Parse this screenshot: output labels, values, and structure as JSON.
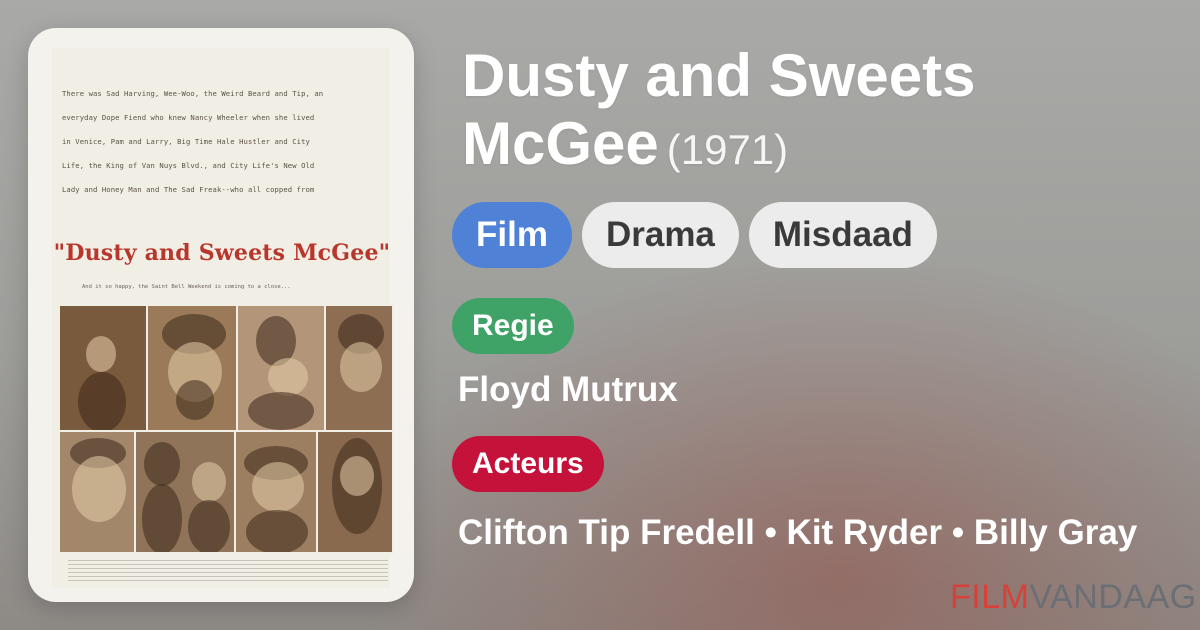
{
  "poster": {
    "blurb": "There was Sad Harving, Wee-Woo, the Weird Beard and Tip, an\neveryday Dope Fiend who knew Nancy Wheeler when she lived\nin Venice, Pam and Larry, Big Time Hale Hustler and City\nLife, the King of Van Nuys Blvd., and City Life's New Old\nLady and Honey Man and The Sad Freak--who all copped from",
    "title": "\"Dusty and Sweets McGee\"",
    "tagline": "And it so happy, the Saint Bell Weekend is coming to a close..."
  },
  "movie": {
    "title": "Dusty and Sweets McGee",
    "year": "(1971)"
  },
  "genres": [
    "Film",
    "Drama",
    "Misdaad"
  ],
  "director": {
    "label": "Regie",
    "name": "Floyd Mutrux"
  },
  "cast": {
    "label": "Acteurs",
    "names": "Clifton Tip Fredell • Kit Ryder • Billy Gray"
  },
  "brand": {
    "part1": "FILM",
    "part2": "VANDAAG"
  },
  "colors": {
    "film_chip": "#4f82d6",
    "regie_badge": "#3fa367",
    "acteurs_badge": "#c4123a",
    "brand_red": "#d7413a"
  }
}
